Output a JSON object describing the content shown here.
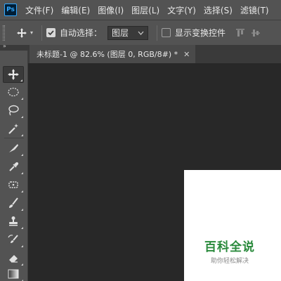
{
  "app": {
    "logo_text": "Ps"
  },
  "menubar": {
    "items": [
      "文件(F)",
      "编辑(E)",
      "图像(I)",
      "图层(L)",
      "文字(Y)",
      "选择(S)",
      "滤镜(T)"
    ]
  },
  "options_bar": {
    "auto_select_label": "自动选择：",
    "auto_select_checked": true,
    "auto_select_target": "图层",
    "show_transform_label": "显示变换控件",
    "show_transform_checked": false
  },
  "document": {
    "tab_title": "未标题-1 @ 82.6% (图层 0, RGB/8#) *"
  },
  "toolbar": {
    "tools": [
      "move-tool",
      "elliptical-marquee-tool",
      "lasso-tool",
      "magic-wand-tool",
      "slice-tool",
      "eyedropper-tool",
      "spot-healing-brush-tool",
      "brush-tool",
      "clone-stamp-tool",
      "history-brush-tool",
      "eraser-tool",
      "gradient-tool"
    ]
  },
  "watermark": {
    "main": "百科全说",
    "sub": "助你轻松解决"
  },
  "colors": {
    "panel": "#535353",
    "canvas_bg": "#282828",
    "artboard": "#ffffff",
    "watermark_green": "#2a8a3c",
    "ps_blue": "#31a8ff"
  }
}
